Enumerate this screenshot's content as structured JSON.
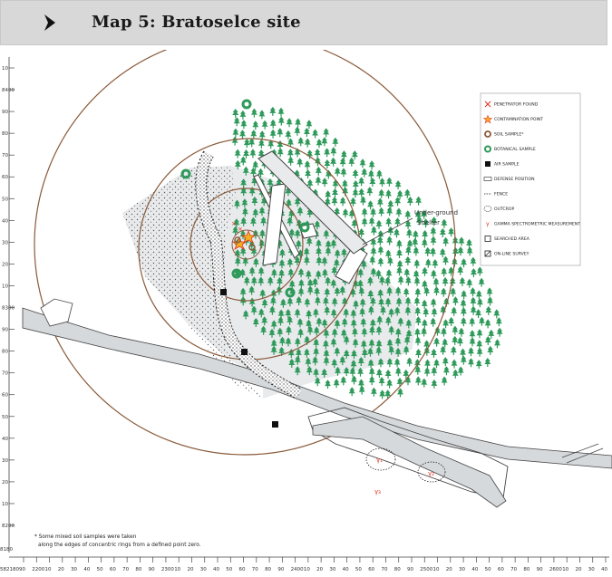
{
  "header": {
    "title": "Map 5: Bratoselce site",
    "chevron_icon": "chevron-right-icon"
  },
  "colors": {
    "header_bg": "#d8d8d8",
    "tree_green": "#2e9a5a",
    "circle_brown": "#8a5a3a",
    "road_gray": "#d6d9dc",
    "contamination_red": "#e0321f"
  },
  "axis": {
    "y_labels": [
      "10",
      "8400",
      "90",
      "80",
      "70",
      "60",
      "50",
      "40",
      "30",
      "20",
      "10",
      "8300",
      "90",
      "80",
      "70",
      "60",
      "50",
      "40",
      "30",
      "20",
      "10",
      "8200"
    ],
    "y_origin_label": "8180",
    "x_origin_label": "582180",
    "x_labels": [
      "90",
      "2200",
      "10",
      "20",
      "30",
      "40",
      "50",
      "60",
      "70",
      "80",
      "90",
      "2300",
      "10",
      "20",
      "30",
      "40",
      "50",
      "60",
      "70",
      "80",
      "90",
      "2400",
      "10",
      "20",
      "30",
      "40",
      "50",
      "60",
      "70",
      "80",
      "90",
      "2500",
      "10",
      "20",
      "30",
      "40",
      "50",
      "60",
      "70",
      "80",
      "90",
      "2600",
      "10",
      "20",
      "30",
      "40"
    ]
  },
  "legend": [
    {
      "icon": "penetrator-icon",
      "label": "PENETRATOR FOUND"
    },
    {
      "icon": "contamination-star-icon",
      "label": "CONTAMINATION POINT"
    },
    {
      "icon": "soil-sample-icon",
      "label": "SOIL SAMPLE*"
    },
    {
      "icon": "botanical-sample-icon",
      "label": "BOTANICAL SAMPLE"
    },
    {
      "icon": "air-sample-icon",
      "label": "AIR SAMPLE"
    },
    {
      "icon": "defense-position-icon",
      "label": "DEFENSE POSITION"
    },
    {
      "icon": "fence-icon",
      "label": "FENCE"
    },
    {
      "icon": "outcrop-icon",
      "label": "OUTCROP"
    },
    {
      "icon": "gamma-icon",
      "label": "GAMMA SPECTROMETRIC MEASUREMENT"
    },
    {
      "icon": "searched-area-icon",
      "label": "SEARCHED AREA"
    },
    {
      "icon": "on-line-survey-icon",
      "label": "ON-LINE SURVEY"
    }
  ],
  "labels": {
    "shelter_line1": "Under-ground",
    "shelter_line2": "Shelter",
    "gamma_1": "γ₁",
    "gamma_2": "γ₂",
    "gamma_3": "γ₃"
  },
  "footnote": {
    "line1": "* Some mixed soil samples were taken",
    "line2": "along the edges of concentric rings from a defined point zero."
  }
}
